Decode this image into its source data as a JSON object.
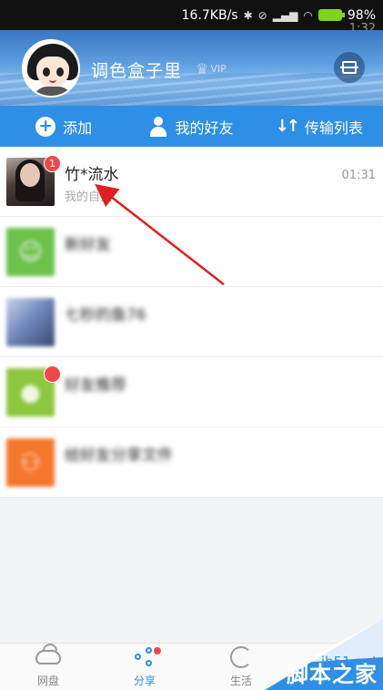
{
  "status_bar": {
    "time": "1:32",
    "speed": "16.7KB/s",
    "battery": "98%"
  },
  "header": {
    "username": "调色盒子里",
    "vip": "VIP"
  },
  "actions": [
    {
      "label": "添加",
      "icon": "plus-icon"
    },
    {
      "label": "我的好友",
      "icon": "user-icon"
    },
    {
      "label": "传输列表",
      "icon": "transfer-icon"
    }
  ],
  "conversations": [
    {
      "title": "竹*流水",
      "subtitle": "我的自拍",
      "time": "01:31",
      "badge": "1",
      "thumb": "photo"
    },
    {
      "title": "新好友",
      "subtitle": "",
      "time": "",
      "badge": "",
      "thumb": "green"
    },
    {
      "title": "七秒的鱼76",
      "subtitle": "",
      "time": "",
      "badge": "",
      "thumb": "blue"
    },
    {
      "title": "好友推荐",
      "subtitle": "",
      "time": "",
      "badge": "",
      "thumb": "olive"
    },
    {
      "title": "给好友分享文件",
      "subtitle": "",
      "time": "",
      "badge": "",
      "thumb": "orange"
    }
  ],
  "bottom_tabs": [
    {
      "label": "网盘",
      "icon": "cloud-icon"
    },
    {
      "label": "分享",
      "icon": "share-icon"
    },
    {
      "label": "生活",
      "icon": "life-icon"
    }
  ],
  "watermark": {
    "site": "jb51.net",
    "brand": "脚本之家"
  },
  "colors": {
    "accent": "#2e8fe6",
    "badge": "#f0464a",
    "arrow": "#e02020"
  }
}
